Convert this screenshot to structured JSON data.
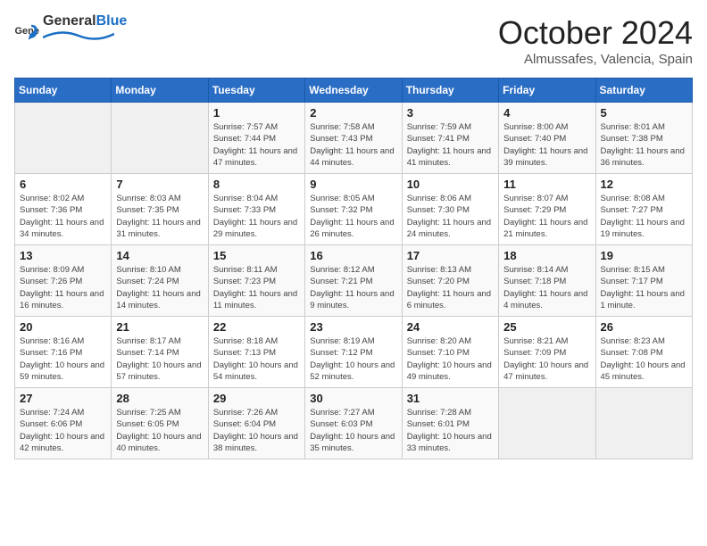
{
  "header": {
    "logo_general": "General",
    "logo_blue": "Blue",
    "month": "October 2024",
    "location": "Almussafes, Valencia, Spain"
  },
  "weekdays": [
    "Sunday",
    "Monday",
    "Tuesday",
    "Wednesday",
    "Thursday",
    "Friday",
    "Saturday"
  ],
  "weeks": [
    [
      {
        "day": "",
        "info": ""
      },
      {
        "day": "",
        "info": ""
      },
      {
        "day": "1",
        "sunrise": "Sunrise: 7:57 AM",
        "sunset": "Sunset: 7:44 PM",
        "daylight": "Daylight: 11 hours and 47 minutes."
      },
      {
        "day": "2",
        "sunrise": "Sunrise: 7:58 AM",
        "sunset": "Sunset: 7:43 PM",
        "daylight": "Daylight: 11 hours and 44 minutes."
      },
      {
        "day": "3",
        "sunrise": "Sunrise: 7:59 AM",
        "sunset": "Sunset: 7:41 PM",
        "daylight": "Daylight: 11 hours and 41 minutes."
      },
      {
        "day": "4",
        "sunrise": "Sunrise: 8:00 AM",
        "sunset": "Sunset: 7:40 PM",
        "daylight": "Daylight: 11 hours and 39 minutes."
      },
      {
        "day": "5",
        "sunrise": "Sunrise: 8:01 AM",
        "sunset": "Sunset: 7:38 PM",
        "daylight": "Daylight: 11 hours and 36 minutes."
      }
    ],
    [
      {
        "day": "6",
        "sunrise": "Sunrise: 8:02 AM",
        "sunset": "Sunset: 7:36 PM",
        "daylight": "Daylight: 11 hours and 34 minutes."
      },
      {
        "day": "7",
        "sunrise": "Sunrise: 8:03 AM",
        "sunset": "Sunset: 7:35 PM",
        "daylight": "Daylight: 11 hours and 31 minutes."
      },
      {
        "day": "8",
        "sunrise": "Sunrise: 8:04 AM",
        "sunset": "Sunset: 7:33 PM",
        "daylight": "Daylight: 11 hours and 29 minutes."
      },
      {
        "day": "9",
        "sunrise": "Sunrise: 8:05 AM",
        "sunset": "Sunset: 7:32 PM",
        "daylight": "Daylight: 11 hours and 26 minutes."
      },
      {
        "day": "10",
        "sunrise": "Sunrise: 8:06 AM",
        "sunset": "Sunset: 7:30 PM",
        "daylight": "Daylight: 11 hours and 24 minutes."
      },
      {
        "day": "11",
        "sunrise": "Sunrise: 8:07 AM",
        "sunset": "Sunset: 7:29 PM",
        "daylight": "Daylight: 11 hours and 21 minutes."
      },
      {
        "day": "12",
        "sunrise": "Sunrise: 8:08 AM",
        "sunset": "Sunset: 7:27 PM",
        "daylight": "Daylight: 11 hours and 19 minutes."
      }
    ],
    [
      {
        "day": "13",
        "sunrise": "Sunrise: 8:09 AM",
        "sunset": "Sunset: 7:26 PM",
        "daylight": "Daylight: 11 hours and 16 minutes."
      },
      {
        "day": "14",
        "sunrise": "Sunrise: 8:10 AM",
        "sunset": "Sunset: 7:24 PM",
        "daylight": "Daylight: 11 hours and 14 minutes."
      },
      {
        "day": "15",
        "sunrise": "Sunrise: 8:11 AM",
        "sunset": "Sunset: 7:23 PM",
        "daylight": "Daylight: 11 hours and 11 minutes."
      },
      {
        "day": "16",
        "sunrise": "Sunrise: 8:12 AM",
        "sunset": "Sunset: 7:21 PM",
        "daylight": "Daylight: 11 hours and 9 minutes."
      },
      {
        "day": "17",
        "sunrise": "Sunrise: 8:13 AM",
        "sunset": "Sunset: 7:20 PM",
        "daylight": "Daylight: 11 hours and 6 minutes."
      },
      {
        "day": "18",
        "sunrise": "Sunrise: 8:14 AM",
        "sunset": "Sunset: 7:18 PM",
        "daylight": "Daylight: 11 hours and 4 minutes."
      },
      {
        "day": "19",
        "sunrise": "Sunrise: 8:15 AM",
        "sunset": "Sunset: 7:17 PM",
        "daylight": "Daylight: 11 hours and 1 minute."
      }
    ],
    [
      {
        "day": "20",
        "sunrise": "Sunrise: 8:16 AM",
        "sunset": "Sunset: 7:16 PM",
        "daylight": "Daylight: 10 hours and 59 minutes."
      },
      {
        "day": "21",
        "sunrise": "Sunrise: 8:17 AM",
        "sunset": "Sunset: 7:14 PM",
        "daylight": "Daylight: 10 hours and 57 minutes."
      },
      {
        "day": "22",
        "sunrise": "Sunrise: 8:18 AM",
        "sunset": "Sunset: 7:13 PM",
        "daylight": "Daylight: 10 hours and 54 minutes."
      },
      {
        "day": "23",
        "sunrise": "Sunrise: 8:19 AM",
        "sunset": "Sunset: 7:12 PM",
        "daylight": "Daylight: 10 hours and 52 minutes."
      },
      {
        "day": "24",
        "sunrise": "Sunrise: 8:20 AM",
        "sunset": "Sunset: 7:10 PM",
        "daylight": "Daylight: 10 hours and 49 minutes."
      },
      {
        "day": "25",
        "sunrise": "Sunrise: 8:21 AM",
        "sunset": "Sunset: 7:09 PM",
        "daylight": "Daylight: 10 hours and 47 minutes."
      },
      {
        "day": "26",
        "sunrise": "Sunrise: 8:23 AM",
        "sunset": "Sunset: 7:08 PM",
        "daylight": "Daylight: 10 hours and 45 minutes."
      }
    ],
    [
      {
        "day": "27",
        "sunrise": "Sunrise: 7:24 AM",
        "sunset": "Sunset: 6:06 PM",
        "daylight": "Daylight: 10 hours and 42 minutes."
      },
      {
        "day": "28",
        "sunrise": "Sunrise: 7:25 AM",
        "sunset": "Sunset: 6:05 PM",
        "daylight": "Daylight: 10 hours and 40 minutes."
      },
      {
        "day": "29",
        "sunrise": "Sunrise: 7:26 AM",
        "sunset": "Sunset: 6:04 PM",
        "daylight": "Daylight: 10 hours and 38 minutes."
      },
      {
        "day": "30",
        "sunrise": "Sunrise: 7:27 AM",
        "sunset": "Sunset: 6:03 PM",
        "daylight": "Daylight: 10 hours and 35 minutes."
      },
      {
        "day": "31",
        "sunrise": "Sunrise: 7:28 AM",
        "sunset": "Sunset: 6:01 PM",
        "daylight": "Daylight: 10 hours and 33 minutes."
      },
      {
        "day": "",
        "info": ""
      },
      {
        "day": "",
        "info": ""
      }
    ]
  ]
}
